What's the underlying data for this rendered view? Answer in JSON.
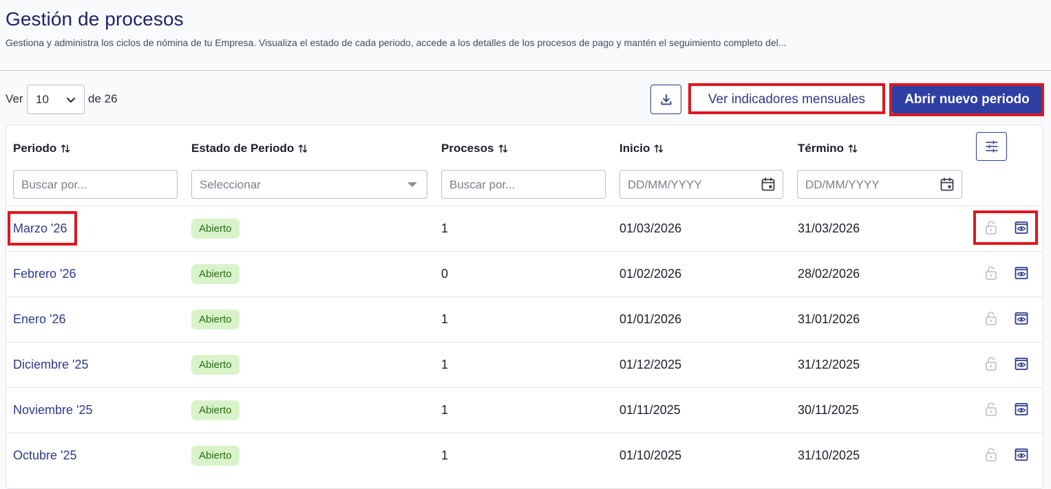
{
  "header": {
    "title": "Gestión de procesos",
    "description": "Gestiona y administra los ciclos de nómina de tu Empresa. Visualiza el estado de cada periodo, accede a los detalles de los procesos de pago y mantén el seguimiento completo del..."
  },
  "toolbar": {
    "ver_label": "Ver",
    "page_size": "10",
    "total_label": "de 26",
    "download_icon": "download-icon",
    "indicators_label": "Ver indicadores mensuales",
    "new_period_label": "Abrir nuevo periodo"
  },
  "table": {
    "columns": [
      {
        "label": "Periodo"
      },
      {
        "label": "Estado de Periodo"
      },
      {
        "label": "Procesos"
      },
      {
        "label": "Inicio"
      },
      {
        "label": "Término"
      }
    ],
    "filters": {
      "periodo_placeholder": "Buscar por...",
      "estado_placeholder": "Seleccionar",
      "procesos_placeholder": "Buscar por...",
      "inicio_placeholder": "DD/MM/YYYY",
      "termino_placeholder": "DD/MM/YYYY"
    },
    "rows": [
      {
        "periodo": "Marzo '26",
        "estado": "Abierto",
        "procesos": "1",
        "inicio": "01/03/2026",
        "termino": "31/03/2026"
      },
      {
        "periodo": "Febrero '26",
        "estado": "Abierto",
        "procesos": "0",
        "inicio": "01/02/2026",
        "termino": "28/02/2026"
      },
      {
        "periodo": "Enero '26",
        "estado": "Abierto",
        "procesos": "1",
        "inicio": "01/01/2026",
        "termino": "31/01/2026"
      },
      {
        "periodo": "Diciembre '25",
        "estado": "Abierto",
        "procesos": "1",
        "inicio": "01/12/2025",
        "termino": "31/12/2025"
      },
      {
        "periodo": "Noviembre '25",
        "estado": "Abierto",
        "procesos": "1",
        "inicio": "01/11/2025",
        "termino": "30/11/2025"
      },
      {
        "periodo": "Octubre '25",
        "estado": "Abierto",
        "procesos": "1",
        "inicio": "01/10/2025",
        "termino": "31/10/2025"
      }
    ]
  },
  "colors": {
    "primary": "#2e3fa3",
    "title": "#1c2566",
    "badge_bg": "#d8f3c9",
    "badge_text": "#2a6b14",
    "highlight": "#e0161e"
  }
}
